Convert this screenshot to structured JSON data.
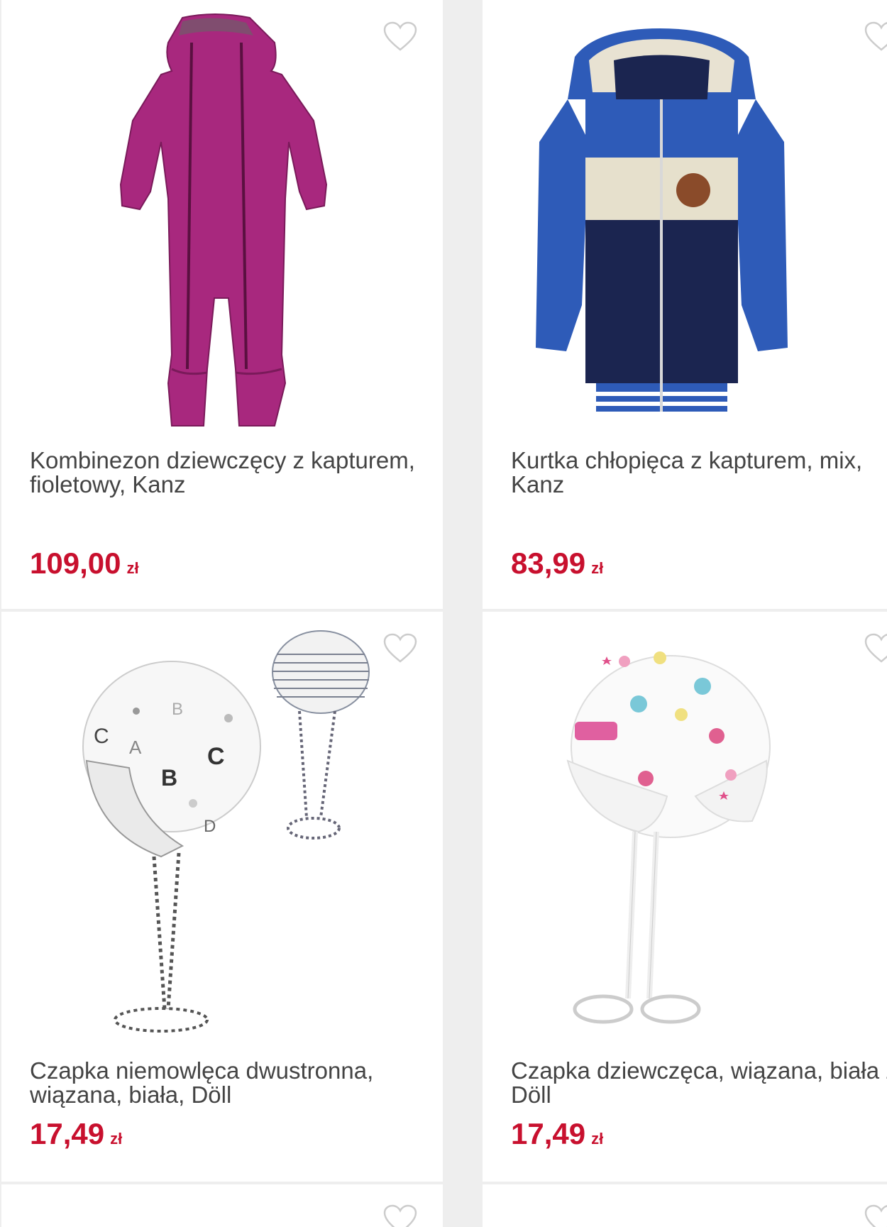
{
  "products": [
    {
      "name": "Kombinezon dziewczęcy z kapturem, fioletowy, Kanz",
      "price": "109,00",
      "currency": "zł",
      "image": "purple-snowsuit"
    },
    {
      "name": "Kurtka chłopięca z kapturem, mix, Kanz",
      "price": "83,99",
      "currency": "zł",
      "image": "blue-jacket"
    },
    {
      "name": "Czapka niemowlęca dwustronna, wiązana, biała, Döll",
      "price": "17,49",
      "currency": "zł",
      "image": "white-abc-hat"
    },
    {
      "name": "Czapka dziewczęca, wiązana, biała zwierzątka, Döll",
      "price": "17,49",
      "currency": "zł",
      "image": "white-dots-hat"
    }
  ],
  "colors": {
    "price": "#c8102e",
    "title": "#444444",
    "background": "#eeeeee",
    "card": "#ffffff",
    "heart_outline": "#cccccc"
  },
  "icons": {
    "favorite": "heart-outline-icon"
  }
}
